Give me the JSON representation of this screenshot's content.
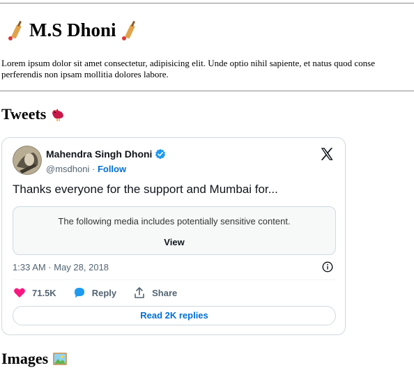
{
  "header": {
    "title": "M.S Dhoni",
    "intro_line1": "Lorem ipsum dolor sit amet consectetur, adipisicing elit. Unde optio nihil sapiente, et natus quod conse",
    "intro_line2": "perferendis non ipsam mollitia dolores labore."
  },
  "sections": {
    "tweets_heading": "Tweets",
    "images_heading": "Images"
  },
  "tweet": {
    "author_name": "Mahendra Singh Dhoni",
    "handle": "@msdhoni",
    "separator": "·",
    "follow_label": "Follow",
    "text": "Thanks everyone for the support and Mumbai for...",
    "sensitive_message": "The following media includes potentially sensitive content.",
    "view_label": "View",
    "timestamp": "1:33 AM · May 28, 2018",
    "likes": "71.5K",
    "reply_label": "Reply",
    "share_label": "Share",
    "read_replies_label": "Read 2K replies"
  },
  "icons": {
    "title_left": "cricket-bat-icon",
    "title_right": "cricket-bat-icon",
    "tweets": "bird-icon",
    "images": "framed-picture-icon",
    "verified": "verified-badge-icon",
    "platform": "x-logo-icon",
    "info": "info-icon",
    "like": "heart-icon",
    "reply": "speech-bubble-icon",
    "share": "share-icon"
  },
  "colors": {
    "link_blue": "#006fd6",
    "like_pink": "#f91880",
    "verified_blue": "#1d9bf0",
    "border": "#cfd9de",
    "secondary_text": "#536471"
  }
}
